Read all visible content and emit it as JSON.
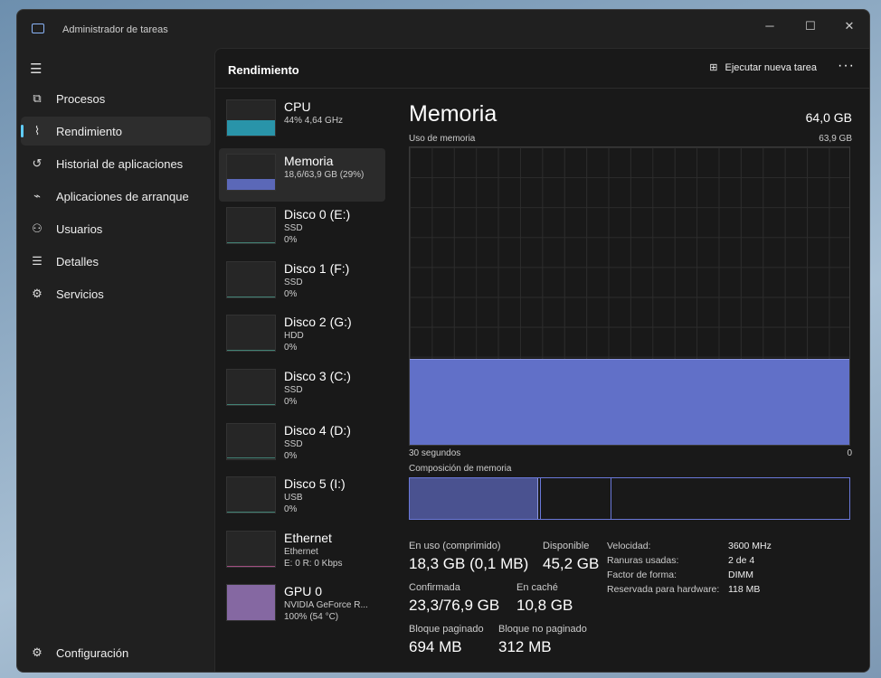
{
  "window": {
    "title": "Administrador de tareas"
  },
  "sidebar": {
    "items": [
      {
        "label": "Procesos",
        "icon": "processes-icon"
      },
      {
        "label": "Rendimiento",
        "icon": "performance-icon"
      },
      {
        "label": "Historial de aplicaciones",
        "icon": "history-icon"
      },
      {
        "label": "Aplicaciones de arranque",
        "icon": "startup-icon"
      },
      {
        "label": "Usuarios",
        "icon": "users-icon"
      },
      {
        "label": "Detalles",
        "icon": "details-icon"
      },
      {
        "label": "Servicios",
        "icon": "services-icon"
      }
    ],
    "settings": "Configuración",
    "active": "Rendimiento"
  },
  "header": {
    "title": "Rendimiento",
    "run_task": "Ejecutar nueva tarea"
  },
  "resources": [
    {
      "name": "CPU",
      "l1": "44% 4,64 GHz",
      "l2": "",
      "color": "#2aa0b8",
      "fill": 44
    },
    {
      "name": "Memoria",
      "l1": "18,6/63,9 GB (29%)",
      "l2": "",
      "color": "#6170c8",
      "fill": 29
    },
    {
      "name": "Disco 0 (E:)",
      "l1": "SSD",
      "l2": "0%",
      "color": "#4a9a8a",
      "fill": 0
    },
    {
      "name": "Disco 1 (F:)",
      "l1": "SSD",
      "l2": "0%",
      "color": "#4a9a8a",
      "fill": 0
    },
    {
      "name": "Disco 2 (G:)",
      "l1": "HDD",
      "l2": "0%",
      "color": "#4a9a8a",
      "fill": 0
    },
    {
      "name": "Disco 3 (C:)",
      "l1": "SSD",
      "l2": "0%",
      "color": "#4a9a8a",
      "fill": 0
    },
    {
      "name": "Disco 4 (D:)",
      "l1": "SSD",
      "l2": "0%",
      "color": "#4a9a8a",
      "fill": 0
    },
    {
      "name": "Disco 5 (I:)",
      "l1": "USB",
      "l2": "0%",
      "color": "#4a9a8a",
      "fill": 0
    },
    {
      "name": "Ethernet",
      "l1": "Ethernet",
      "l2": "E: 0 R: 0 Kbps",
      "color": "#c25a9a",
      "fill": 0
    },
    {
      "name": "GPU 0",
      "l1": "NVIDIA GeForce R...",
      "l2": "100%  (54 °C)",
      "color": "#9070b0",
      "fill": 100
    }
  ],
  "memory": {
    "title": "Memoria",
    "total": "64,0 GB",
    "usage_label": "Uso de memoria",
    "usage_max": "63,9 GB",
    "x_left": "30 segundos",
    "x_right": "0",
    "usage_percent": 29,
    "composition_label": "Composición de memoria",
    "stats": {
      "in_use_label": "En uso (comprimido)",
      "in_use": "18,3 GB (0,1 MB)",
      "available_label": "Disponible",
      "available": "45,2 GB",
      "committed_label": "Confirmada",
      "committed": "23,3/76,9 GB",
      "cached_label": "En caché",
      "cached": "10,8 GB",
      "paged_label": "Bloque paginado",
      "paged": "694 MB",
      "nonpaged_label": "Bloque no paginado",
      "nonpaged": "312 MB"
    },
    "details": [
      {
        "k": "Velocidad:",
        "v": "3600 MHz"
      },
      {
        "k": "Ranuras usadas:",
        "v": "2 de 4"
      },
      {
        "k": "Factor de forma:",
        "v": "DIMM"
      },
      {
        "k": "Reservada para hardware:",
        "v": "118 MB"
      }
    ]
  }
}
